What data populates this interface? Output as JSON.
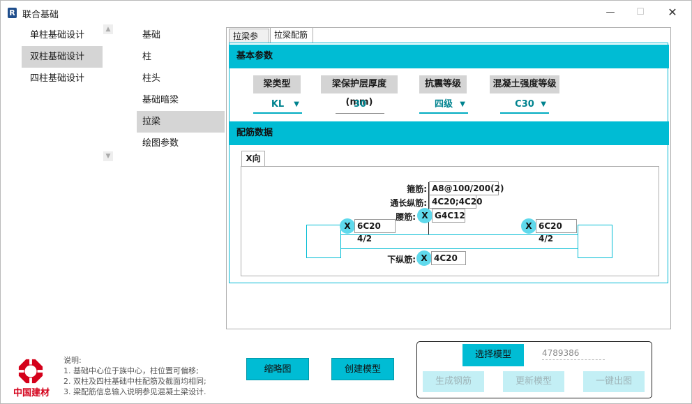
{
  "window": {
    "title": "联合基础",
    "minimize": "—",
    "maximize": "☐",
    "close": "✕",
    "logo": "R"
  },
  "nav1": {
    "items": [
      {
        "label": "单柱基础设计",
        "active": false
      },
      {
        "label": "双柱基础设计",
        "active": true
      },
      {
        "label": "四柱基础设计",
        "active": false
      }
    ]
  },
  "nav2": {
    "items": [
      {
        "label": "基础",
        "active": false
      },
      {
        "label": "柱",
        "active": false
      },
      {
        "label": "柱头",
        "active": false
      },
      {
        "label": "基础暗梁",
        "active": false
      },
      {
        "label": "拉梁",
        "active": true
      },
      {
        "label": "绘图参数",
        "active": false
      }
    ]
  },
  "tabs": {
    "t1": "拉梁参数",
    "t2": "拉梁配筋"
  },
  "basic": {
    "header": "基本参数",
    "beam_type": {
      "label": "梁类型",
      "value": "KL"
    },
    "cover": {
      "label": "梁保护层厚度(mm)",
      "value": "30"
    },
    "seismic": {
      "label": "抗震等级",
      "value": "四级"
    },
    "concrete": {
      "label": "混凝土强度等级",
      "value": "C30"
    }
  },
  "rebar": {
    "header": "配筋数据",
    "x_tab": "X向",
    "stirrup": {
      "label": "箍筋:",
      "value": "A8@100/200(2)"
    },
    "through": {
      "label": "通长纵筋:",
      "value": "4C20;4C20"
    },
    "waist": {
      "label": "腰筋:",
      "value": "G4C12"
    },
    "left_top": "6C20 4/2",
    "right_top": "6C20 4/2",
    "bottom": {
      "label": "下纵筋:",
      "value": "4C20"
    },
    "x_mark": "X"
  },
  "notes": {
    "title": "说明:",
    "line1": "1. 基础中心位于族中心，柱位置可偏移;",
    "line2": "2. 双柱及四柱基础中柱配筋及截面均相同;",
    "line3": "3. 梁配筋信息输入说明参见混凝土梁设计."
  },
  "brand": {
    "name": "中国建材",
    "color": "#d4001a"
  },
  "buttons": {
    "thumbnail": "缩略图",
    "create_model": "创建模型",
    "select_model": "选择模型",
    "generate_rebar": "生成钢筋",
    "update_model": "更新模型",
    "export": "一键出图"
  },
  "model_id": "4789386",
  "colors": {
    "accent": "#00bcd4",
    "badge": "#5fd9ec"
  }
}
